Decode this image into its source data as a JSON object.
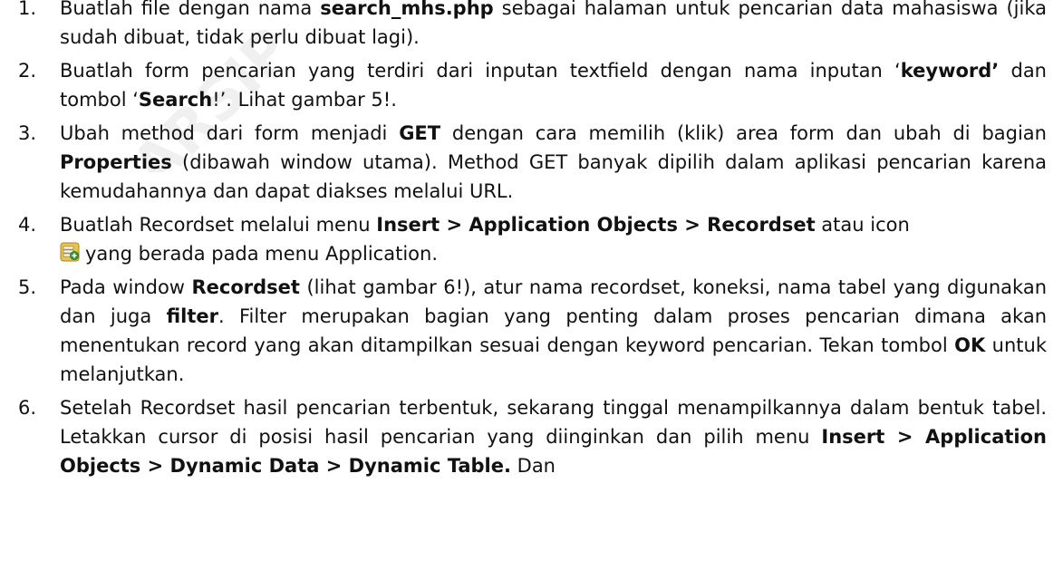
{
  "steps": [
    {
      "num": "1.",
      "t1": "Buatlah file dengan nama ",
      "b1": "search_mhs.php",
      "t2": " sebagai halaman untuk pencarian data mahasiswa (jika sudah dibuat, tidak perlu dibuat lagi)."
    },
    {
      "num": "2.",
      "t1": "Buatlah form pencarian yang terdiri dari inputan textfield dengan nama inputan ‘",
      "b1": "keyword’",
      "t2": " dan tombol ‘",
      "b2": "Search",
      "t3": "!’. Lihat gambar 5!."
    },
    {
      "num": "3.",
      "t1": "Ubah method dari form menjadi ",
      "b1": "GET",
      "t2": " dengan cara memilih (klik) area form dan ubah di bagian ",
      "b2": "Properties",
      "t3": " (dibawah window utama). Method GET banyak dipilih dalam aplikasi pencarian karena kemudahannya dan dapat diakses melalui URL."
    },
    {
      "num": "4.",
      "t1": "Buatlah Recordset melalui menu ",
      "b1": "Insert > Application Objects > Recordset",
      "t2": " atau icon",
      "icon": "recordset-icon",
      "t3": "yang berada pada menu Application."
    },
    {
      "num": "5.",
      "t1": "Pada window ",
      "b1": "Recordset",
      "t2": " (lihat gambar 6!), atur nama recordset, koneksi, nama tabel yang digunakan dan juga ",
      "b2": "filter",
      "t3": ". Filter merupakan bagian yang penting dalam proses pencarian dimana akan menentukan record yang akan ditampilkan sesuai dengan keyword pencarian. Tekan tombol ",
      "b3": "OK",
      "t4": " untuk melanjutkan."
    },
    {
      "num": "6.",
      "t1": "Setelah Recordset hasil pencarian terbentuk, sekarang tinggal menampilkannya dalam bentuk tabel. Letakkan cursor di posisi hasil pencarian yang diinginkan dan pilih menu ",
      "b1": "Insert > Application Objects > Dynamic Data > Dynamic Table.",
      "t2": " Dan"
    }
  ],
  "colors": {
    "text": "#111111",
    "icon_yellow": "#e8c44a",
    "icon_green": "#3a9b3a"
  }
}
